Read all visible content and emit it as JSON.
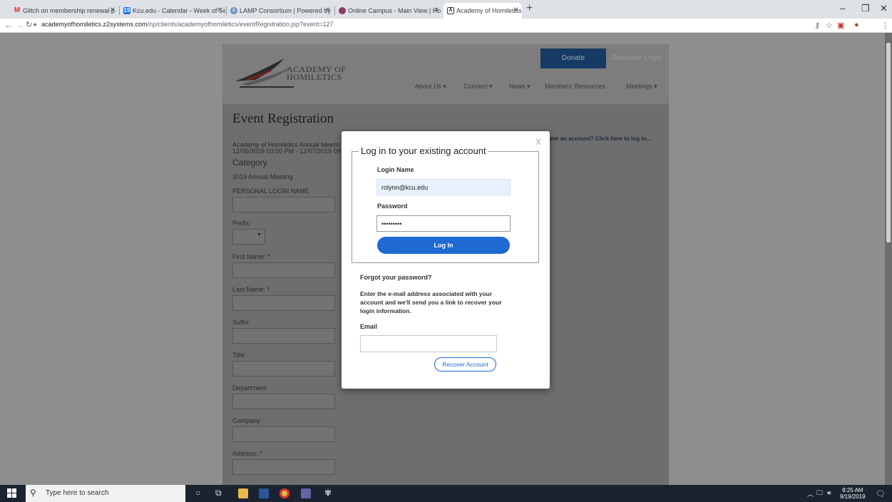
{
  "browser": {
    "tabs": [
      {
        "title": "Glitch on membership renewal p",
        "icon": "gmail-icon",
        "color": "#d93025"
      },
      {
        "title": "Kcu.edu - Calendar - Week of Se",
        "icon": "calendar-icon",
        "color": "#1a73e8"
      },
      {
        "title": "LAMP Consortium | Powered by",
        "icon": "lamp-icon",
        "color": "#6b8fb8"
      },
      {
        "title": "Online Campus - Main View | Ho",
        "icon": "campus-icon",
        "color": "#8b3a62"
      },
      {
        "title": "Academy of Homiletics | Academ",
        "icon": "academy-icon",
        "color": "#333333"
      }
    ],
    "url_host": "academyofhomiletics.z2systems.com",
    "url_path": "/np/clients/academyofhomiletics/eventRegistration.jsp?event=127"
  },
  "site": {
    "logo_line1": "ACADEMY OF",
    "logo_line2": "HOMILETICS",
    "donate": "Donate",
    "resource_login": "Resource Login",
    "nav": [
      "About Us  ▾",
      "Connect  ▾",
      "News  ▾",
      "Members' Resources",
      "Meetings  ▾"
    ],
    "page_title": "Event Registration",
    "meeting_name": "Academy of Homiletics Annual Meetin",
    "meeting_dates": "12/05/2019 03:00 PM - 12/07/2019 09",
    "category_label": "Category",
    "category_value": "2019 Annual Meeting",
    "have_account": "ave an account? Click here to log in...",
    "fields": {
      "personal_login": "PERSONAL LOGIN NAME",
      "prefix": "Prefix:",
      "first_name": "First Name: *",
      "last_name": "Last Name: *",
      "suffix": "Suffix:",
      "title": "Title:",
      "department": "Department:",
      "company": "Company:",
      "address": "Address: *"
    }
  },
  "modal": {
    "close": "X",
    "legend": "Log in to your existing account",
    "login_name_label": "Login Name",
    "login_name_value": "rolynn@kcu.edu",
    "password_label": "Password",
    "password_value": "•••••••••",
    "login_button": "Log In",
    "forgot_title": "Forgot your password?",
    "forgot_text": "Enter the e-mail address associated with your account and we'll send you a link to recover your login information.",
    "email_label": "Email",
    "recover_button": "Recover Account"
  },
  "taskbar": {
    "search_placeholder": "Type here to search",
    "time": "8:25 AM",
    "date": "9/19/2019"
  }
}
